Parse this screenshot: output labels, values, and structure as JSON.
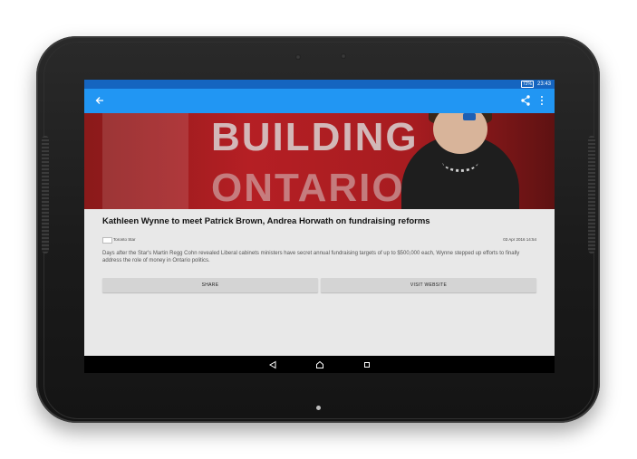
{
  "status_bar": {
    "battery": "72%",
    "time": "23:43"
  },
  "icons": {
    "back": "arrow-left-icon",
    "share": "share-icon",
    "more": "overflow-menu-icon",
    "nav_back": "triangle-back-icon",
    "nav_home": "circle-home-icon",
    "nav_recents": "square-recents-icon"
  },
  "colors": {
    "app_bar": "#2196f3",
    "status_bar": "#1565c0",
    "background": "#e8e8e8",
    "button": "#d4d4d4"
  },
  "hero": {
    "sign_line1": "BUILDING",
    "sign_line2": "ONTARIO"
  },
  "article": {
    "headline": "Kathleen Wynne to meet Patrick Brown, Andrea Horwath on fundraising reforms",
    "source": "Toronto Star",
    "date": "03 Apr 2016 14:54",
    "summary": "Days after the Star's Martin Regg Cohn revealed Liberal cabinets ministers have secret annual fundraising targets of up to $500,000 each, Wynne stepped up efforts to finally address the role of money in Ontario politics."
  },
  "actions": {
    "share_label": "SHARE",
    "visit_label": "VISIT WEBSITE"
  }
}
